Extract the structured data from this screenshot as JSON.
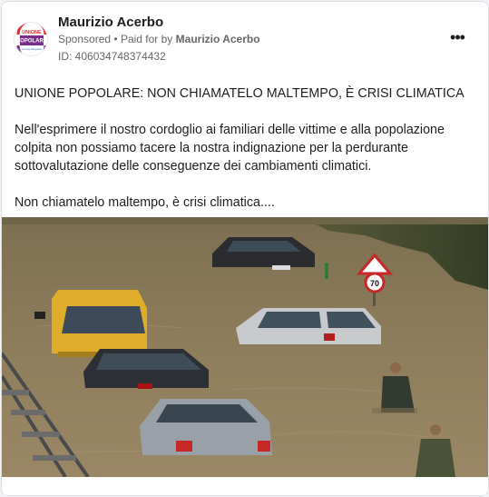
{
  "post": {
    "author": "Maurizio Acerbo",
    "sponsored": "Sponsored",
    "separator": "•",
    "paid_for_prefix": "Paid for by",
    "paid_for_name": "Maurizio Acerbo",
    "ad_id": "ID: 406034748374432",
    "more_label": "•••",
    "avatar_logo": {
      "line1": "UNIONE",
      "line2": "POPOLARE",
      "line3": "con De Magistris",
      "colors": [
        "#e3262c",
        "#f29d1e",
        "#2a6fd6",
        "#7b2d8b"
      ]
    },
    "text_title": "UNIONE POPOLARE: NON CHIAMATELO MALTEMPO, È CRISI CLIMATICA",
    "text_paragraph": "Nell'esprimere il nostro cordoglio ai familiari delle vittime e alla popolazione colpita non possiamo tacere la nostra indignazione per la perdurante sottovalutazione delle conseguenze dei cambiamenti climatici.",
    "text_closing": "Non chiamatelo maltempo, è crisi climatica....",
    "image_description_icon": "flood-photo"
  },
  "colors": {
    "water": "#8a7a5a",
    "text_primary": "#1c1e21",
    "text_secondary": "#65676b"
  }
}
